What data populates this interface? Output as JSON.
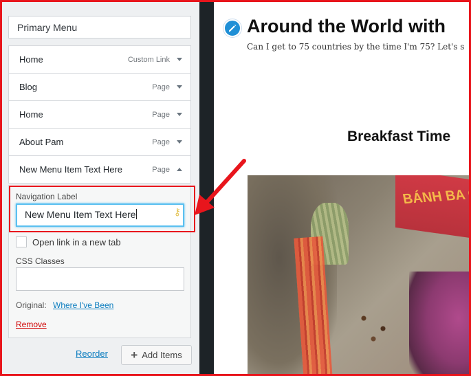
{
  "menu_panel": {
    "menu_name": "Primary Menu",
    "items": [
      {
        "label": "Home",
        "type": "Custom Link",
        "expanded": false
      },
      {
        "label": "Blog",
        "type": "Page",
        "expanded": false
      },
      {
        "label": "Home",
        "type": "Page",
        "expanded": false
      },
      {
        "label": "About Pam",
        "type": "Page",
        "expanded": false
      },
      {
        "label": "New Menu Item Text Here",
        "type": "Page",
        "expanded": true
      }
    ],
    "settings": {
      "navigation_label_title": "Navigation Label",
      "navigation_label_value": "New Menu Item Text Here",
      "open_new_tab_label": "Open link in a new tab",
      "open_new_tab_checked": false,
      "css_classes_title": "CSS Classes",
      "css_classes_value": "",
      "original_label": "Original:",
      "original_link": "Where I've Been",
      "remove_label": "Remove"
    },
    "footer": {
      "reorder_label": "Reorder",
      "add_items_label": "Add Items"
    }
  },
  "preview": {
    "site_title": "Around the World with",
    "tagline": "Can I get to 75 countries by the time I'm 75? Let's s",
    "post_title": "Breakfast Time",
    "photo_sign_text": "BÁNH BA G"
  },
  "colors": {
    "annotation_red": "#e8151c",
    "link_blue": "#0a7cbf",
    "focus_blue": "#5bc0f0",
    "remove_red": "#d10000",
    "edit_icon_blue": "#1f8fd6"
  },
  "icons": {
    "item_toggle": "chevron-down-icon",
    "item_toggle_open": "chevron-up-icon",
    "add_items": "plus-icon",
    "edit_shortcut": "pencil-icon",
    "password_key": "key-icon",
    "annotation": "arrow-icon"
  }
}
